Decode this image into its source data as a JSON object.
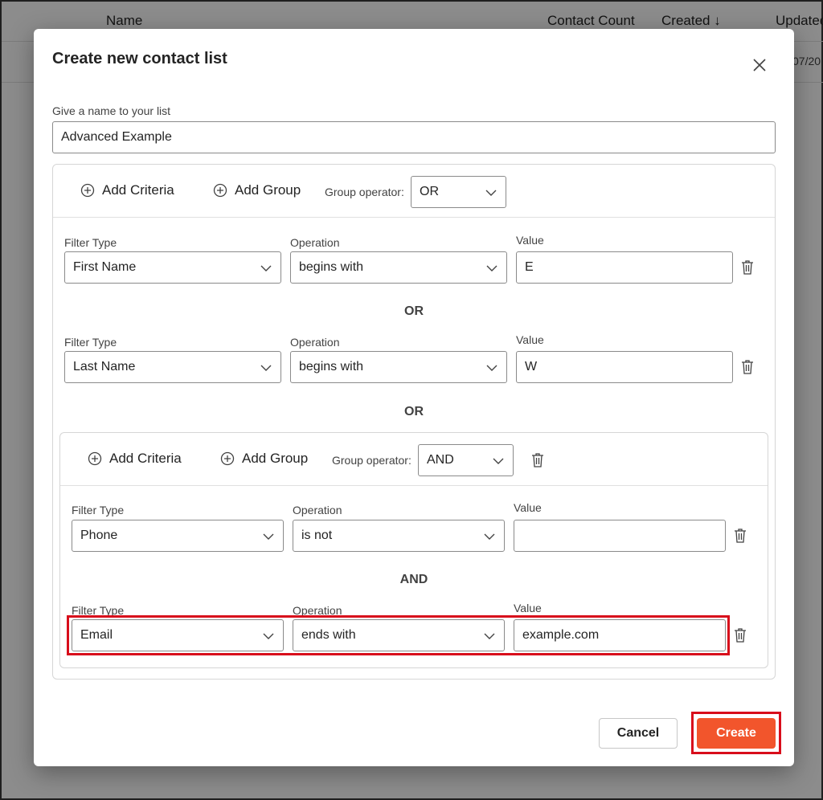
{
  "background": {
    "columns": {
      "name": "Name",
      "contact_count": "Contact Count",
      "created": "Created ↓",
      "updated": "Updated"
    },
    "row_date_fragment": "07/20"
  },
  "dialog": {
    "title": "Create new contact list",
    "close_icon": "close-icon",
    "name_label": "Give a name to your list",
    "name_value": "Advanced Example",
    "root_group": {
      "add_criteria": "Add Criteria",
      "add_group": "Add Group",
      "group_operator_label": "Group operator:",
      "group_operator": "OR",
      "criteria": [
        {
          "filter_type_label": "Filter Type",
          "filter_type": "First Name",
          "operation_label": "Operation",
          "operation": "begins with",
          "value_label": "Value",
          "value": "E"
        },
        {
          "filter_type_label": "Filter Type",
          "filter_type": "Last Name",
          "operation_label": "Operation",
          "operation": "begins with",
          "value_label": "Value",
          "value": "W"
        }
      ],
      "separators": [
        "OR",
        "OR"
      ]
    },
    "nested_group": {
      "add_criteria": "Add Criteria",
      "add_group": "Add Group",
      "group_operator_label": "Group operator:",
      "group_operator": "AND",
      "criteria": [
        {
          "filter_type_label": "Filter Type",
          "filter_type": "Phone",
          "operation_label": "Operation",
          "operation": "is not",
          "value_label": "Value",
          "value": ""
        },
        {
          "filter_type_label": "Filter Type",
          "filter_type": "Email",
          "operation_label": "Operation",
          "operation": "ends with",
          "value_label": "Value",
          "value": "example.com"
        }
      ],
      "separator": "AND"
    },
    "buttons": {
      "cancel": "Cancel",
      "create": "Create"
    }
  },
  "colors": {
    "accent": "#f2552c",
    "highlight": "#d80d1b"
  }
}
